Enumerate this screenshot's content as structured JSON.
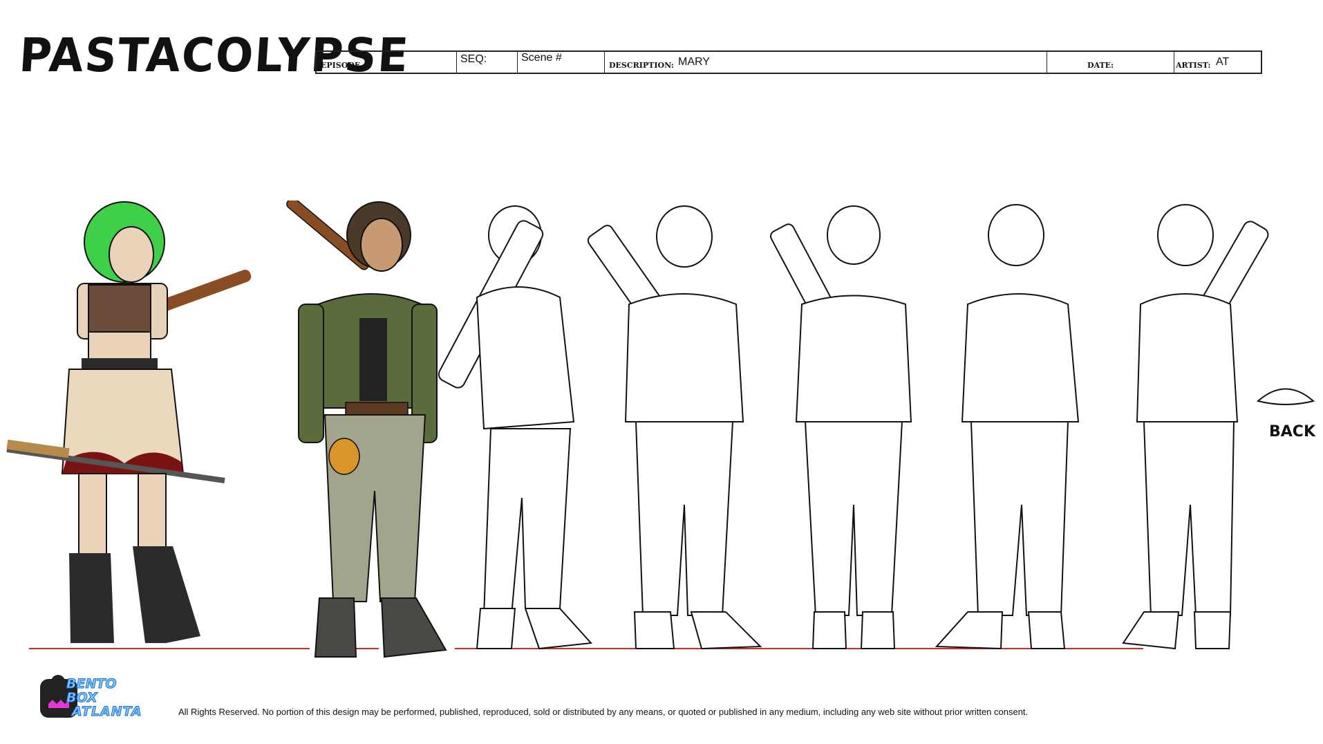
{
  "title": "PASTACOLYPSE",
  "header": {
    "episode_label": "EPISODE #",
    "episode_value": "",
    "seq_label": "SEQ:",
    "scene_label": "Scene #",
    "description_label": "DESCRIPTION:",
    "description_value": "MARY",
    "date_label": "DATE:",
    "date_value": "",
    "artist_label": "ARTIST:",
    "artist_value": "AT"
  },
  "views": [
    {
      "name": "color-reference",
      "fill": "#3fd04a"
    },
    {
      "name": "color-model",
      "fill": "#5a6b3c"
    },
    {
      "name": "three-quarter-back",
      "fill": "none"
    },
    {
      "name": "three-quarter-front",
      "fill": "none"
    },
    {
      "name": "front",
      "fill": "none"
    },
    {
      "name": "three-quarter-front-right",
      "fill": "none"
    },
    {
      "name": "back",
      "fill": "none"
    }
  ],
  "back_note": "BACK",
  "logo": {
    "line1": "BENTO",
    "line2": "BOX",
    "line3": "ATLANTA",
    "brand_color": "#7ec8f8",
    "accent_color": "#e23ad8"
  },
  "footer": "All Rights Reserved. No portion of this design may be performed, published, reproduced, sold or distributed by any means, or quoted or published in any medium, including any web site without prior written consent.",
  "colors": {
    "ground_line": "#d8262a",
    "jacket": "#5a6b3c",
    "pants": "#a2a58c",
    "hair_green": "#3fd04a",
    "wood": "#8a4d23"
  }
}
